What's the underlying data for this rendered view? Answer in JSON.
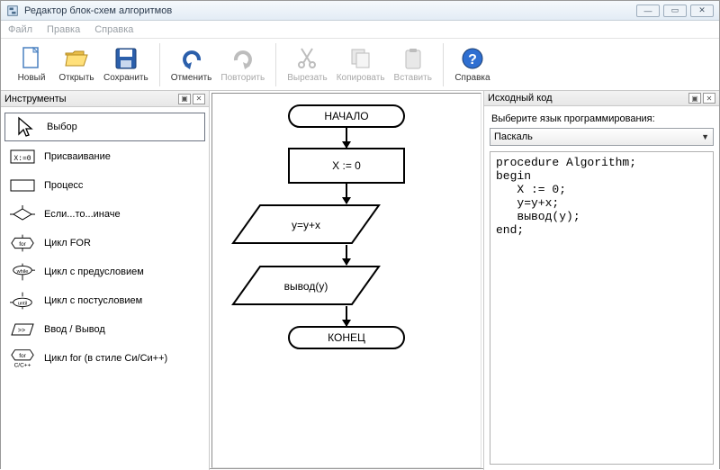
{
  "window": {
    "title": "Редактор блок-схем алгоритмов"
  },
  "menu": {
    "file": "Файл",
    "edit": "Правка",
    "help": "Справка"
  },
  "toolbar": {
    "new": "Новый",
    "open": "Открыть",
    "save": "Сохранить",
    "undo": "Отменить",
    "redo": "Повторить",
    "cut": "Вырезать",
    "copy": "Копировать",
    "paste": "Вставить",
    "help": "Справка"
  },
  "panels": {
    "tools_title": "Инструменты",
    "source_title": "Исходный код"
  },
  "tools": [
    {
      "label": "Выбор",
      "icon": "cursor",
      "selected": true
    },
    {
      "label": "Присваивание",
      "icon": "assign",
      "selected": false
    },
    {
      "label": "Процесс",
      "icon": "process",
      "selected": false
    },
    {
      "label": "Если...то...иначе",
      "icon": "if",
      "selected": false
    },
    {
      "label": "Цикл FOR",
      "icon": "for",
      "selected": false
    },
    {
      "label": "Цикл с предусловием",
      "icon": "while",
      "selected": false
    },
    {
      "label": "Цикл с постусловием",
      "icon": "until",
      "selected": false
    },
    {
      "label": "Ввод / Вывод",
      "icon": "io",
      "selected": false
    },
    {
      "label": "Цикл for (в стиле Си/Си++)",
      "icon": "cfor",
      "selected": false
    }
  ],
  "flowchart": {
    "start": "НАЧАЛО",
    "n1": "X := 0",
    "n2": "y=y+x",
    "n3": "вывод(y)",
    "end": "КОНЕЦ"
  },
  "source": {
    "lang_prompt": "Выберите язык программирования:",
    "lang_selected": "Паскаль",
    "code": "procedure Algorithm;\nbegin\n   X := 0;\n   y=y+x;\n   вывод(y);\nend;"
  }
}
